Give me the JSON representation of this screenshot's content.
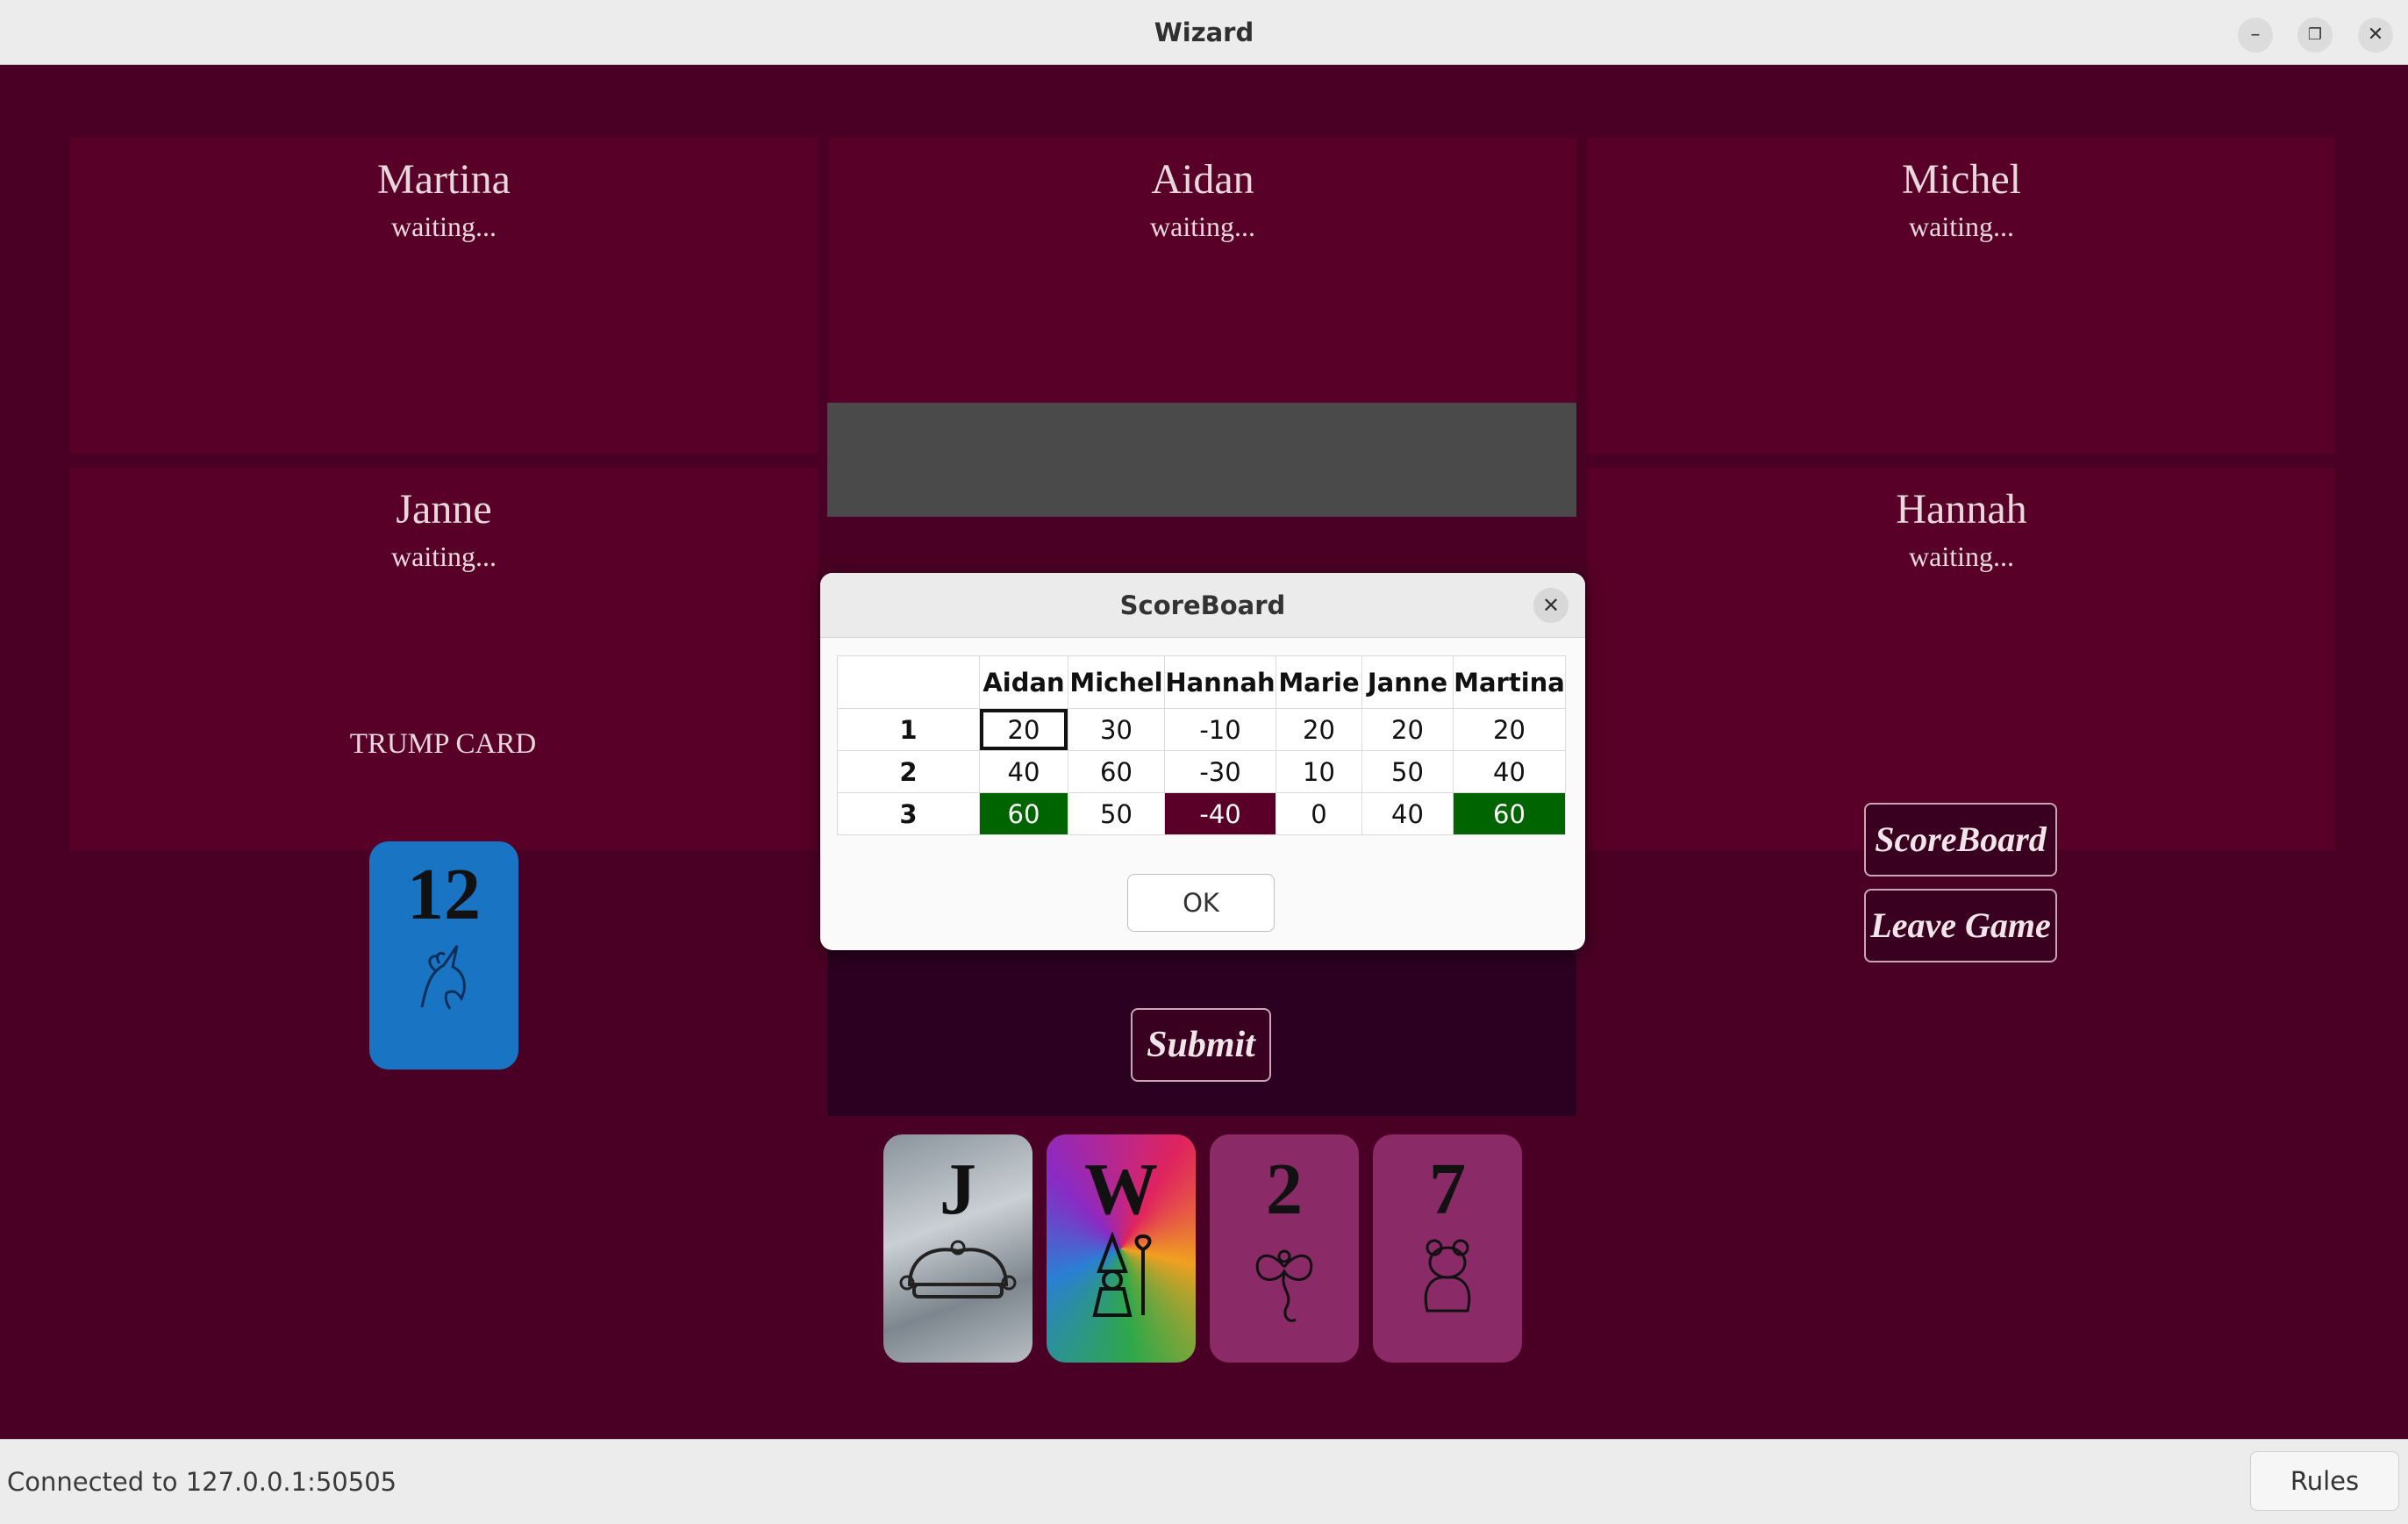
{
  "window": {
    "title": "Wizard"
  },
  "players": [
    {
      "name": "Martina",
      "status": "waiting..."
    },
    {
      "name": "Aidan",
      "status": "waiting..."
    },
    {
      "name": "Michel",
      "status": "waiting..."
    },
    {
      "name": "Janne",
      "status": "waiting..."
    },
    {
      "name": "Hannah",
      "status": "waiting..."
    }
  ],
  "trump": {
    "label": "TRUMP CARD",
    "value": "12",
    "color": "#1a74c4",
    "icon": "unicorn-icon"
  },
  "buttons": {
    "submit": "Submit",
    "scoreboard": "ScoreBoard",
    "leave": "Leave Game",
    "rules": "Rules"
  },
  "hand": [
    {
      "value": "J",
      "icon": "jester-hat-icon",
      "style": "clouds"
    },
    {
      "value": "W",
      "icon": "wizard-icon",
      "style": "rainbow"
    },
    {
      "value": "2",
      "icon": "fairy-icon",
      "color": "#8a2a66"
    },
    {
      "value": "7",
      "icon": "bear-icon",
      "color": "#8a2a66"
    }
  ],
  "status": "Connected to 127.0.0.1:50505",
  "scoreboard": {
    "title": "ScoreBoard",
    "columns": [
      "Aidan",
      "Michel",
      "Hannah",
      "Marie",
      "Janne",
      "Martina"
    ],
    "rows": [
      {
        "round": "1",
        "values": [
          "20",
          "30",
          "-10",
          "20",
          "20",
          "20"
        ]
      },
      {
        "round": "2",
        "values": [
          "40",
          "60",
          "-30",
          "10",
          "50",
          "40"
        ]
      },
      {
        "round": "3",
        "values": [
          "60",
          "50",
          "-40",
          "0",
          "40",
          "60"
        ]
      }
    ],
    "ok": "OK"
  }
}
